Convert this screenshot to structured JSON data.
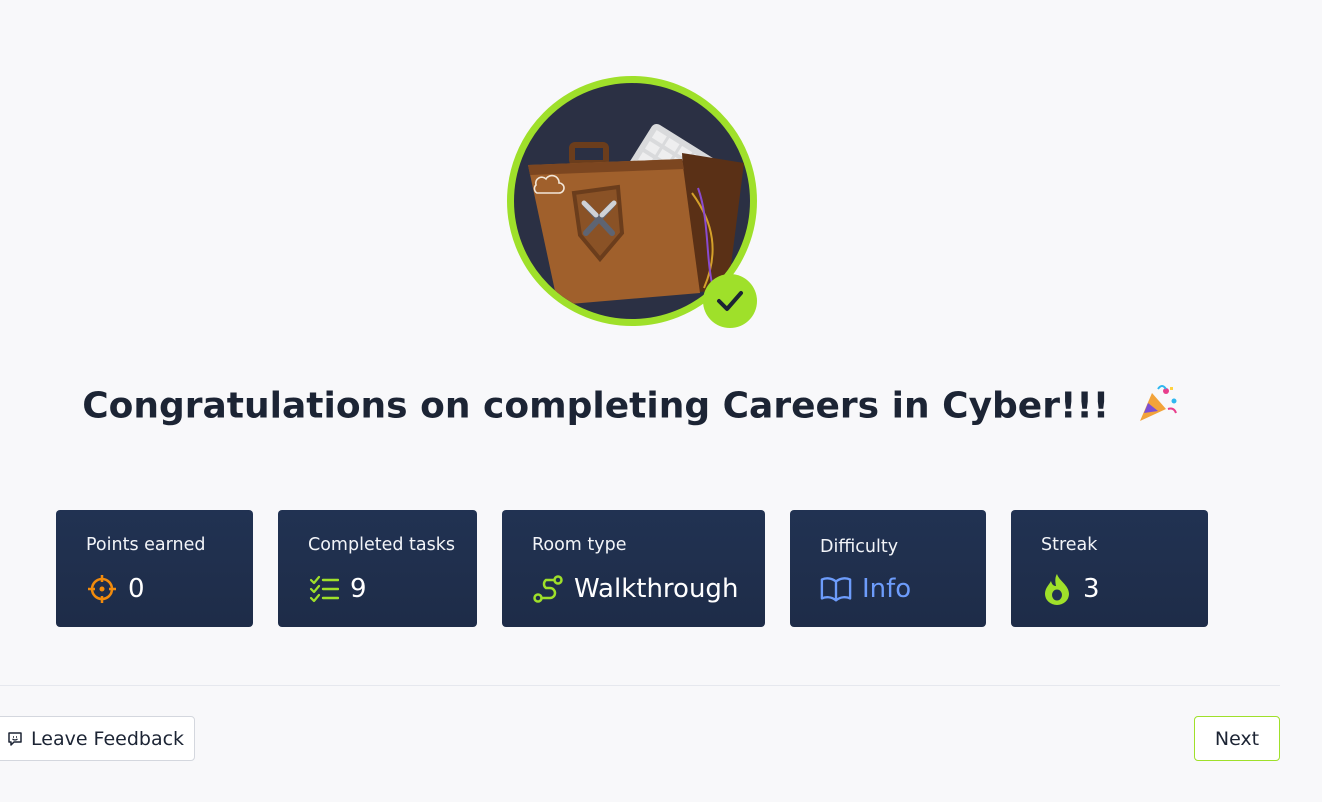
{
  "badge": {
    "image": "careers-in-cyber-briefcase-badge",
    "check_icon": "checkmark-icon",
    "colors": {
      "ring": "#9fe02a",
      "background": "#2b3044"
    }
  },
  "title": {
    "text": "Congratulations on completing Careers in Cyber!!!",
    "emoji_icon": "party-popper-icon"
  },
  "stats": [
    {
      "label": "Points earned",
      "value": "0",
      "icon": "crosshair-icon",
      "icon_color": "#f28b0c"
    },
    {
      "label": "Completed tasks",
      "value": "9",
      "icon": "checklist-icon",
      "icon_color": "#9fe02a"
    },
    {
      "label": "Room type",
      "value": "Walkthrough",
      "icon": "route-icon",
      "icon_color": "#9fe02a"
    },
    {
      "label": "Difficulty",
      "value": "Info",
      "icon": "book-icon",
      "icon_color": "#6d9cfb"
    },
    {
      "label": "Streak",
      "value": "3",
      "icon": "flame-icon",
      "icon_color": "#9fe02a"
    }
  ],
  "footer": {
    "feedback_label": "Leave Feedback",
    "feedback_icon": "message-icon",
    "next_label": "Next"
  },
  "colors": {
    "accent": "#9fe02a",
    "card": "#213252",
    "page": "#f8f8fa"
  }
}
